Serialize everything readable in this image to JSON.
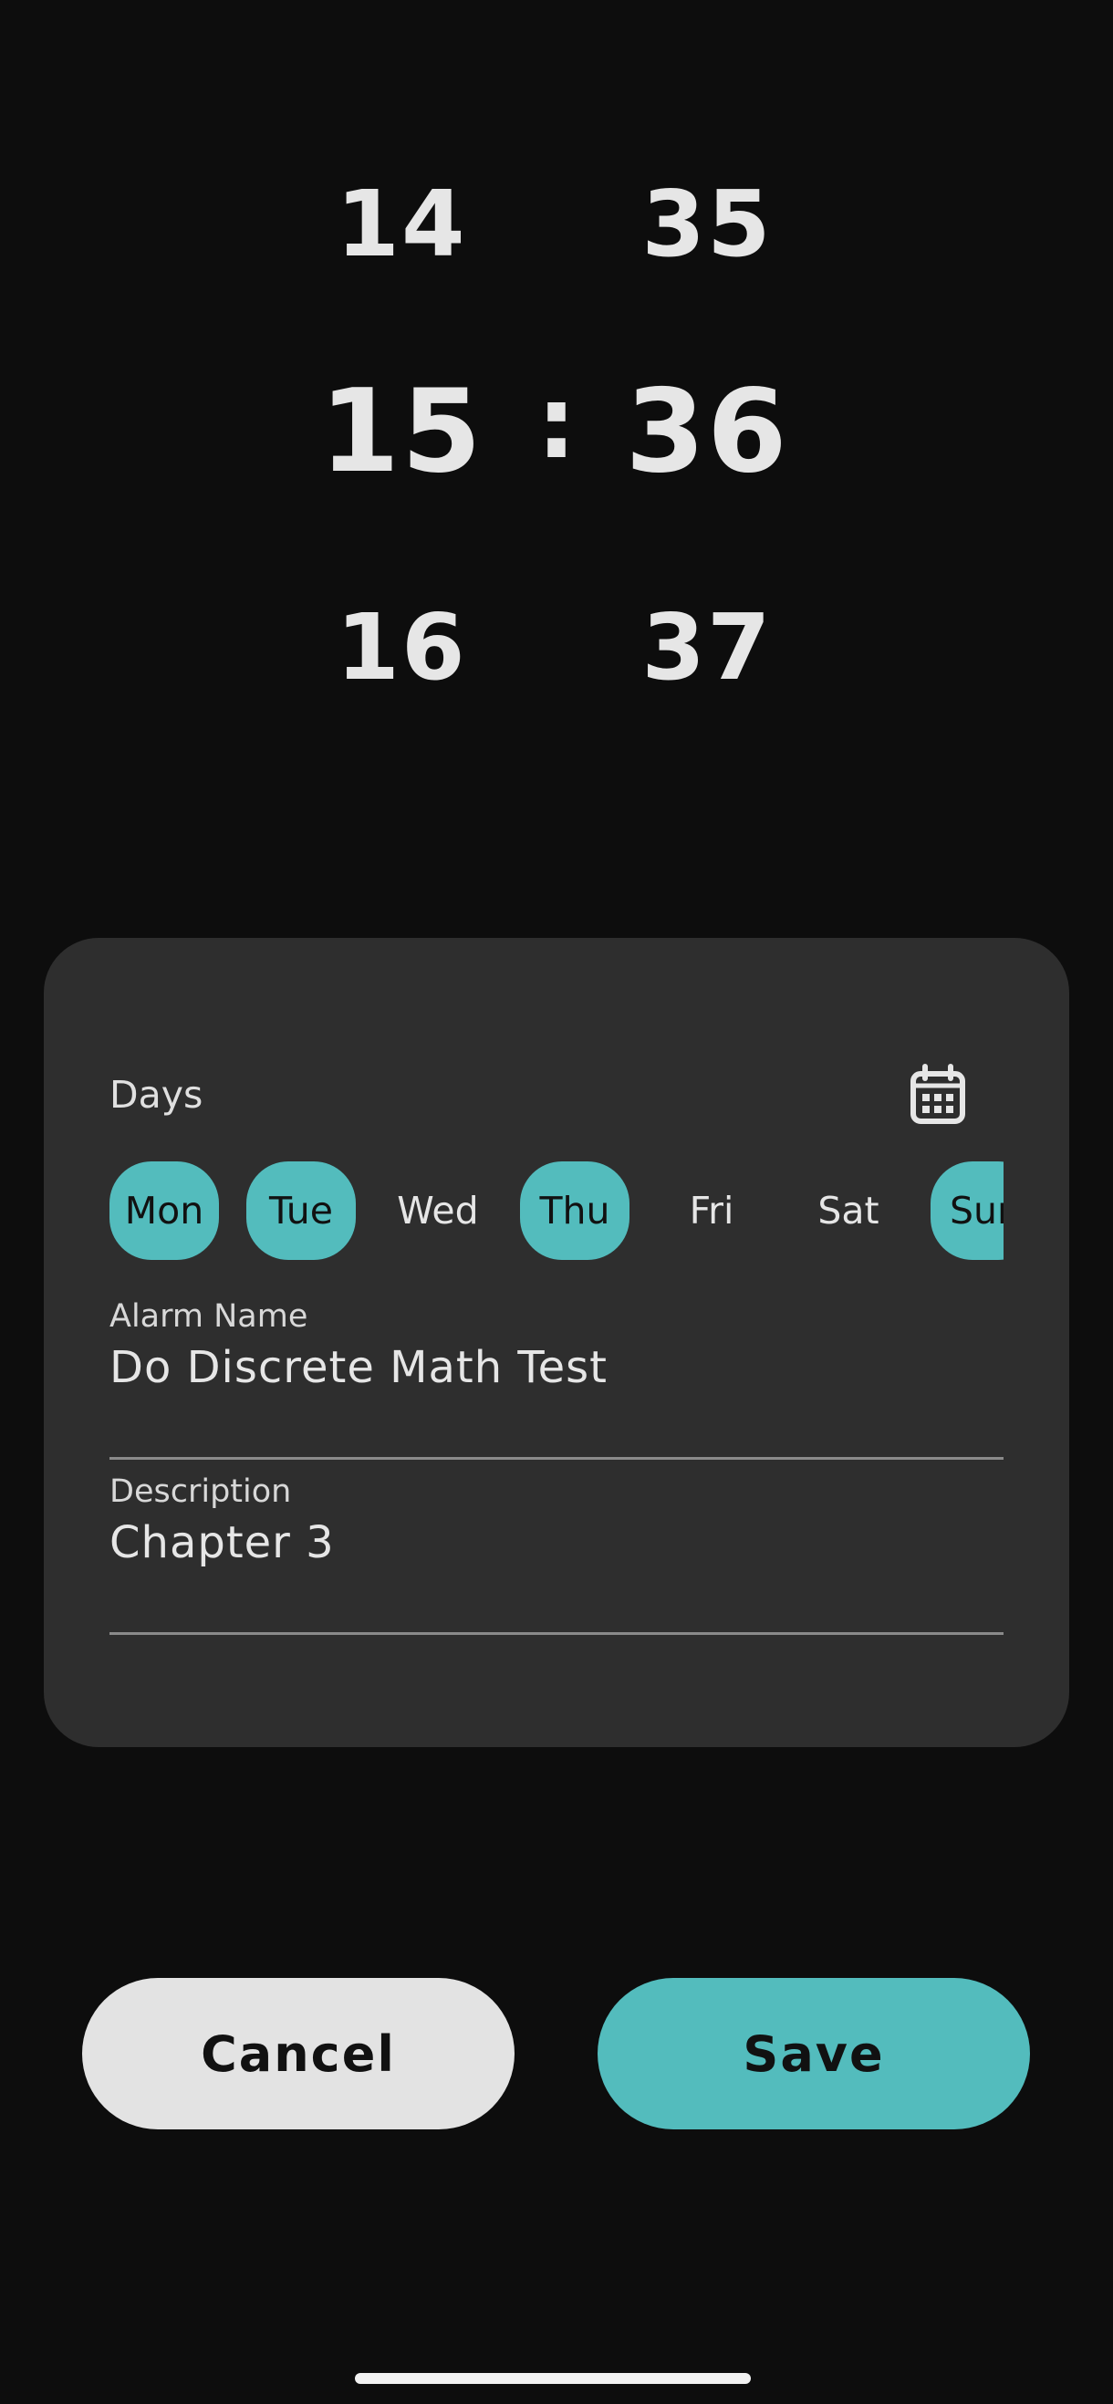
{
  "time_picker": {
    "hours": [
      "14",
      "15",
      "16"
    ],
    "minutes": [
      "35",
      "36",
      "37"
    ],
    "separator": ":"
  },
  "card": {
    "days_label": "Days",
    "calendar_icon": "calendar-icon",
    "days": [
      {
        "label": "Mon",
        "selected": true
      },
      {
        "label": "Tue",
        "selected": true
      },
      {
        "label": "Wed",
        "selected": false
      },
      {
        "label": "Thu",
        "selected": true
      },
      {
        "label": "Fri",
        "selected": false
      },
      {
        "label": "Sat",
        "selected": false
      },
      {
        "label": "Sun",
        "selected": true
      }
    ],
    "alarm_name": {
      "label": "Alarm Name",
      "value": "Do Discrete Math Test"
    },
    "description": {
      "label": "Description",
      "value": "Chapter 3"
    }
  },
  "actions": {
    "cancel_label": "Cancel",
    "save_label": "Save"
  },
  "colors": {
    "accent": "#53bcbd",
    "background": "#0d0d0d",
    "card": "#2e2e2e"
  }
}
